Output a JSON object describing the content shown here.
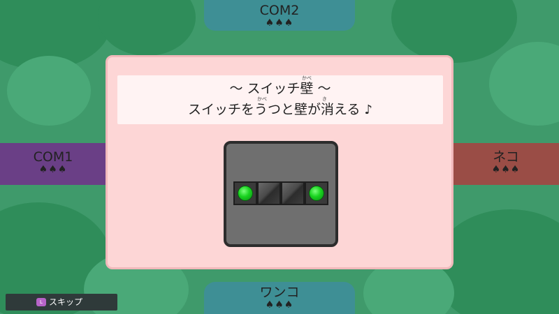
{
  "players": {
    "top": {
      "name": "COM2",
      "lives": "♠♠♠"
    },
    "left": {
      "name": "COM1",
      "lives": "♠♠♠"
    },
    "right": {
      "name": "ネコ",
      "lives": "♠♠♠"
    },
    "bottom": {
      "name": "ワンコ",
      "lives": "♠♠♠"
    }
  },
  "dialog": {
    "title": "～ スイッチ壁 ～",
    "description": "スイッチをうつと壁が消える",
    "furigana_title": "かべ",
    "furigana_desc_wall": "かべ",
    "furigana_desc_vanish": "き"
  },
  "preview": {
    "tiles": [
      "switch",
      "block",
      "block",
      "switch"
    ]
  },
  "skip": {
    "key": "L",
    "label": "スキップ"
  }
}
